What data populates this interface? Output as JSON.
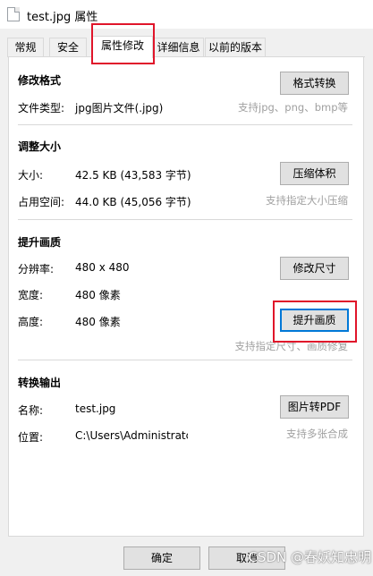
{
  "window": {
    "title": "test.jpg 属性"
  },
  "tabs": [
    {
      "label": "常规"
    },
    {
      "label": "安全"
    },
    {
      "label": "属性修改"
    },
    {
      "label": "详细信息"
    },
    {
      "label": "以前的版本"
    }
  ],
  "sections": {
    "format": {
      "title": "修改格式",
      "type_label": "文件类型:",
      "type_value": "jpg图片文件(.jpg)",
      "button": "格式转换",
      "hint": "支持jpg、png、bmp等"
    },
    "size": {
      "title": "调整大小",
      "size_label": "大小:",
      "size_value": "42.5 KB (43,583 字节)",
      "disk_label": "占用空间:",
      "disk_value": "44.0 KB (45,056 字节)",
      "button": "压缩体积",
      "hint": "支持指定大小压缩"
    },
    "quality": {
      "title": "提升画质",
      "resolution_label": "分辨率:",
      "resolution_value": "480 x 480",
      "width_label": "宽度:",
      "width_value": "480 像素",
      "height_label": "高度:",
      "height_value": "480 像素",
      "resize_button": "修改尺寸",
      "enhance_button": "提升画质",
      "hint": "支持指定尺寸、画质修复"
    },
    "convert": {
      "title": "转换输出",
      "name_label": "名称:",
      "name_value": "test.jpg",
      "location_label": "位置:",
      "location_value": "C:\\Users\\Administratc",
      "button": "图片转PDF",
      "hint": "支持多张合成"
    }
  },
  "footer": {
    "ok": "确定",
    "cancel": "取消"
  },
  "watermark": "CSDN @春妖知忠明",
  "colors": {
    "highlight": "#e0152a",
    "focus": "#0078d7"
  }
}
